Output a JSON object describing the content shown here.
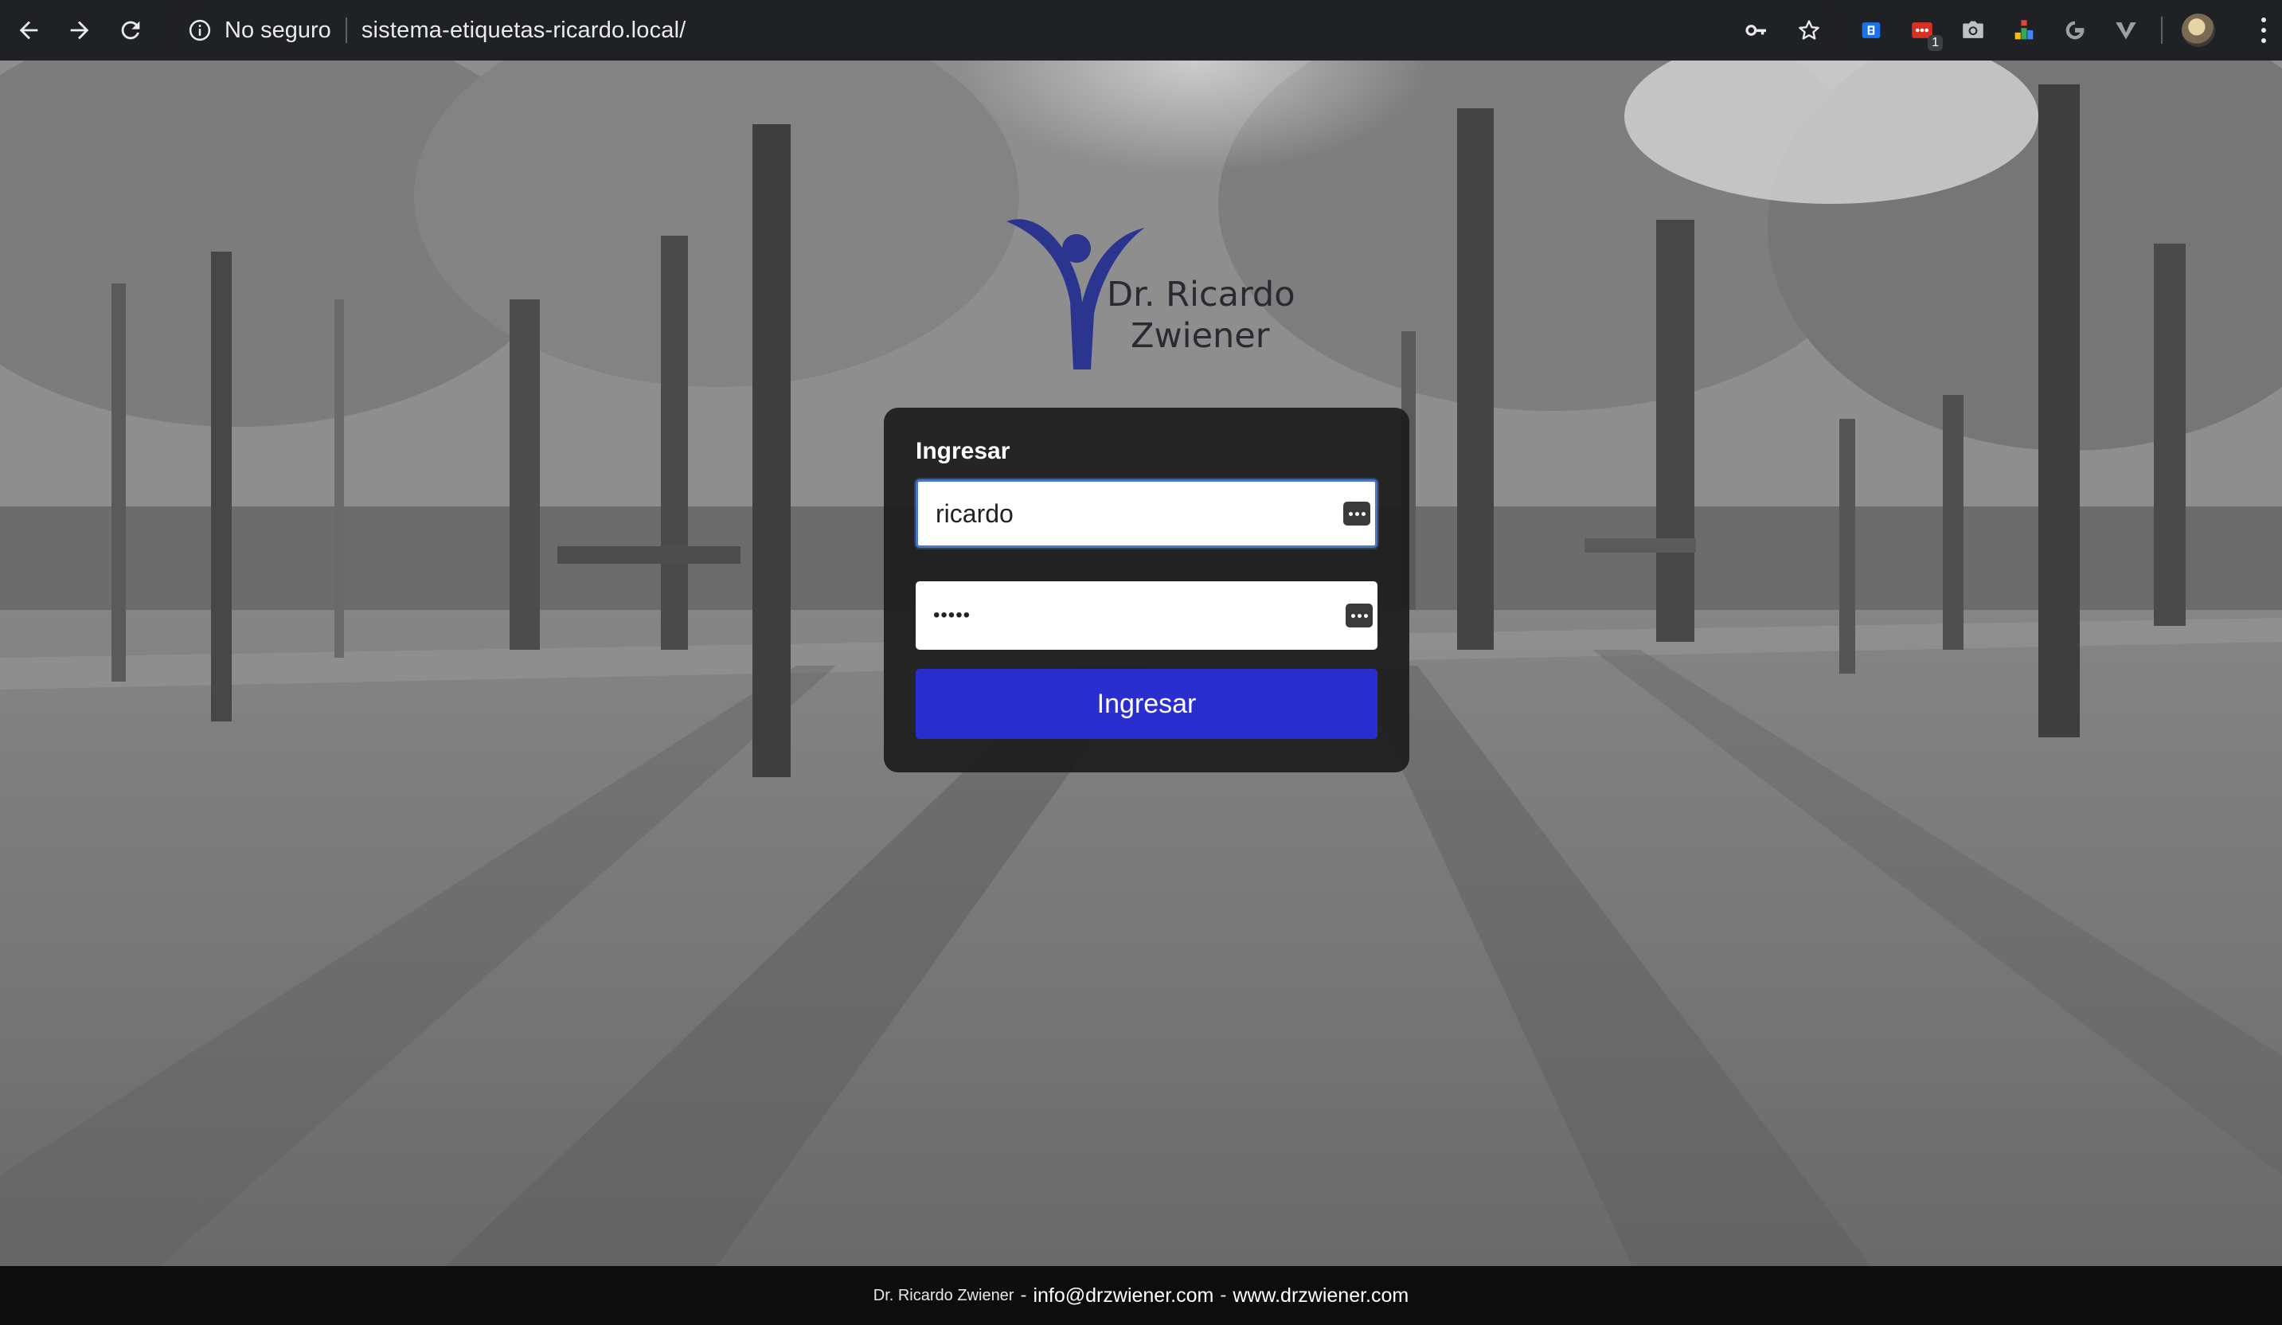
{
  "browser": {
    "security_label": "No seguro",
    "url": "sistema-etiquetas-ricardo.local/",
    "extension_badge": "1",
    "icons": [
      "back-arrow-icon",
      "forward-arrow-icon",
      "reload-icon",
      "info-icon",
      "key-icon",
      "star-icon",
      "extension-icon",
      "camera-icon",
      "menu-icon"
    ]
  },
  "logo": {
    "line1": "Dr. Ricardo",
    "line2": "Zwiener",
    "brand_color": "#2b3590"
  },
  "login": {
    "title": "Ingresar",
    "username_value": "ricardo",
    "password_value": "•••••",
    "submit_label": "Ingresar",
    "button_color": "#2b2ecf"
  },
  "footer": {
    "name": "Dr. Ricardo Zwiener",
    "separator": "-",
    "email": "info@drzwiener.com",
    "website": "www.drzwiener.com"
  }
}
